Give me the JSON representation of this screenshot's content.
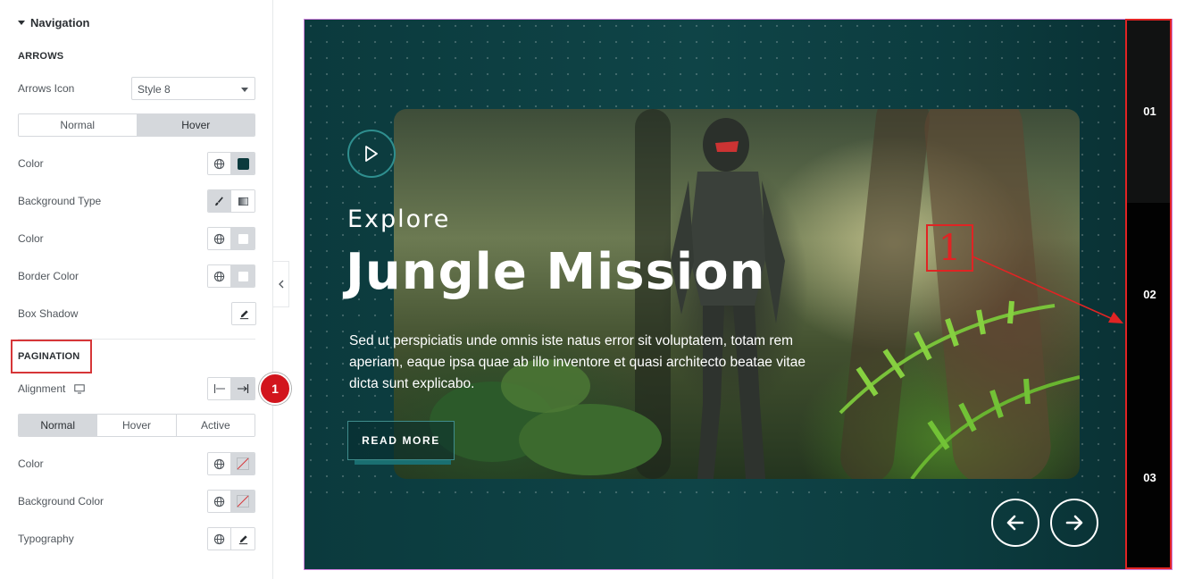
{
  "panel": {
    "section_title": "Navigation",
    "arrows_heading": "ARROWS",
    "arrows_icon_label": "Arrows Icon",
    "arrows_icon_value": "Style 8",
    "arrow_tabs": [
      "Normal",
      "Hover"
    ],
    "arrow_active_tab": "Hover",
    "rows": {
      "color": "Color",
      "background_type": "Background Type",
      "color2": "Color",
      "border_color": "Border Color",
      "box_shadow": "Box Shadow"
    },
    "arrow_color_swatch": "#0b3a3d",
    "pagination_heading": "PAGINATION",
    "alignment_label": "Alignment",
    "pagination_tabs": [
      "Normal",
      "Hover",
      "Active"
    ],
    "pagination_active_tab": "Normal",
    "pag_rows": {
      "color": "Color",
      "background_color": "Background Color",
      "typography": "Typography"
    },
    "badge": "1"
  },
  "preview": {
    "subtitle": "Explore",
    "title": "Jungle Mission",
    "description": "Sed ut perspiciatis unde omnis iste natus error sit voluptatem, totam rem aperiam, eaque ipsa quae ab illo inventore et quasi architecto beatae vitae dicta sunt explicabo.",
    "button": "READ MORE",
    "pages": [
      "01",
      "02",
      "03"
    ],
    "active_page": "01"
  },
  "annotation": {
    "label": "1",
    "color": "#e02424"
  }
}
